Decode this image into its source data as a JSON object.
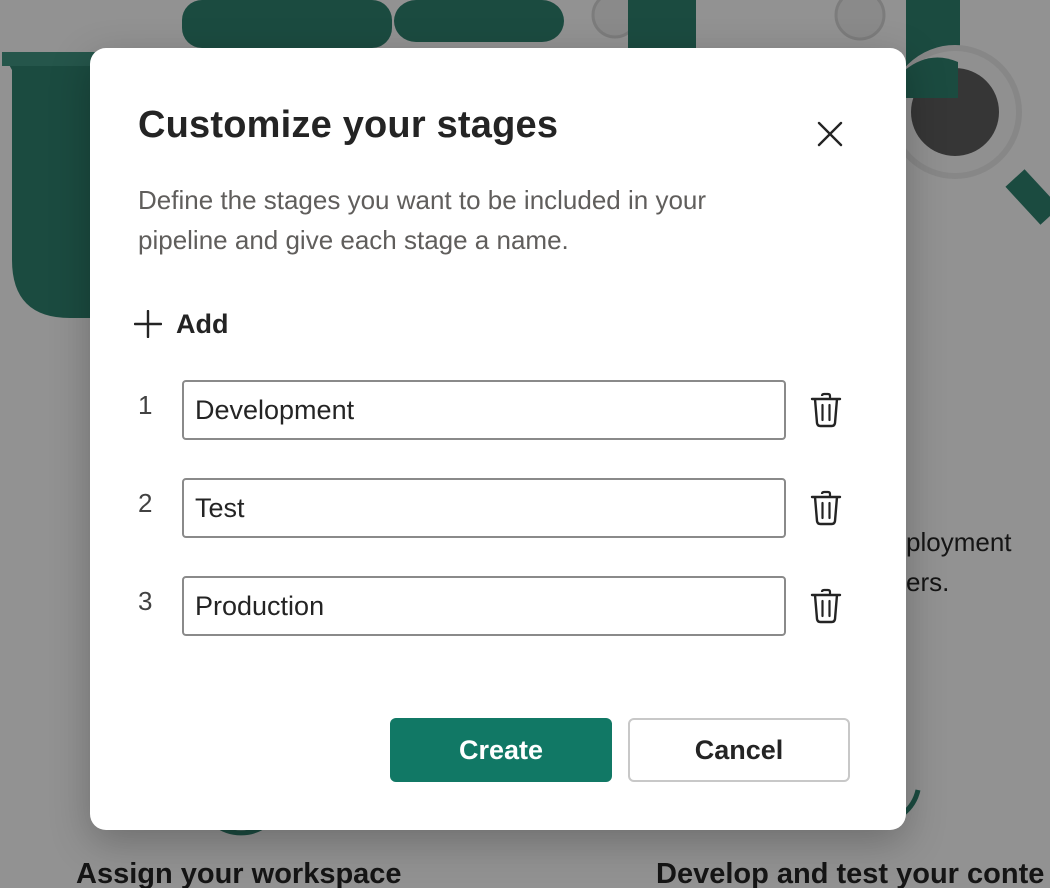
{
  "background": {
    "description_line_1": "ployment",
    "description_line_2": "ers.",
    "step_left_heading": "Assign your workspace",
    "step_right_heading": "Develop and test your conte"
  },
  "dialog": {
    "title": "Customize your stages",
    "description": "Define the stages you want to be included in your pipeline and give each stage a name.",
    "close_icon": "close-icon",
    "add_label": "Add",
    "add_icon": "plus-icon",
    "stages": [
      {
        "number": "1",
        "value": "Development",
        "delete_icon": "trash-icon"
      },
      {
        "number": "2",
        "value": "Test",
        "delete_icon": "trash-icon"
      },
      {
        "number": "3",
        "value": "Production",
        "delete_icon": "trash-icon"
      }
    ],
    "create_label": "Create",
    "cancel_label": "Cancel"
  },
  "colors": {
    "accent": "#117865",
    "illustration": "#2e7d6c",
    "overlay": "rgba(0,0,0,0.40)"
  }
}
